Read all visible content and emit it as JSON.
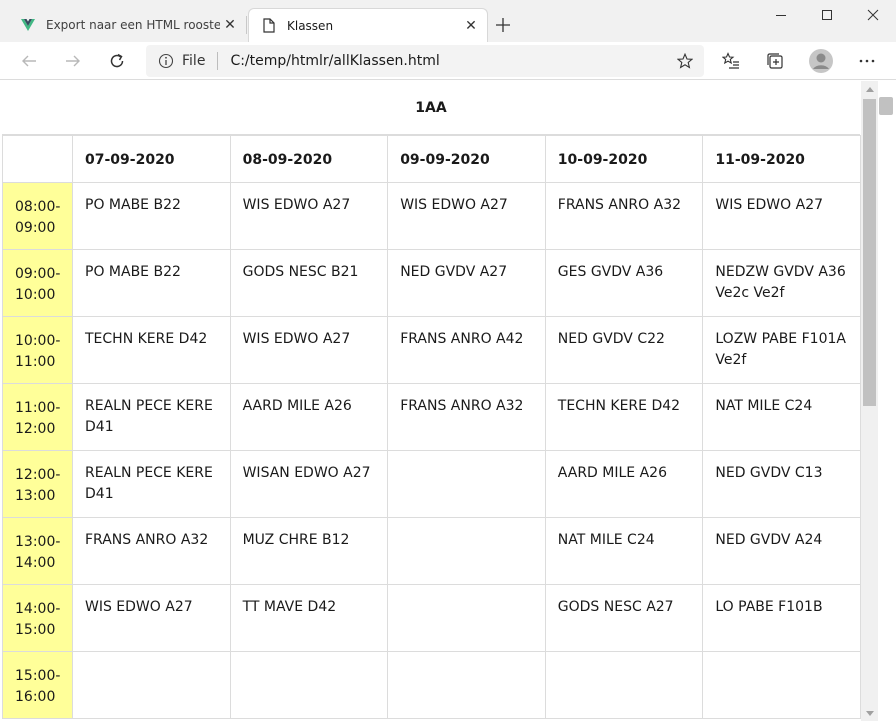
{
  "tabs": [
    {
      "title": "Export naar een HTML rooster –",
      "active": false
    },
    {
      "title": "Klassen",
      "active": true
    }
  ],
  "address": {
    "scheme": "File",
    "url": "C:/temp/htmlr/allKlassen.html"
  },
  "icons": {
    "tab1": "vue-logo-icon",
    "tab2": "page-icon",
    "back": "back-arrow-icon",
    "forward": "forward-arrow-icon",
    "reload": "reload-icon",
    "info": "info-icon",
    "favorite": "star-icon",
    "favorites": "favorites-icon",
    "collections": "collections-icon",
    "profile": "profile-icon",
    "menu": "more-icon"
  },
  "colors": {
    "time_cell": "#ffff99",
    "grid": "#dcdcdc"
  },
  "page": {
    "class_name": "1AA",
    "days": [
      "07-09-2020",
      "08-09-2020",
      "09-09-2020",
      "10-09-2020",
      "11-09-2020"
    ],
    "rows": [
      {
        "time": "08:00-09:00",
        "cells": [
          "PO MABE B22",
          "WIS EDWO A27",
          "WIS EDWO A27",
          "FRANS ANRO A32",
          "WIS EDWO A27"
        ]
      },
      {
        "time": "09:00-10:00",
        "cells": [
          "PO MABE B22",
          "GODS NESC B21",
          "NED GVDV A27",
          "GES GVDV A36",
          "NEDZW GVDV A36 Ve2c Ve2f"
        ]
      },
      {
        "time": "10:00-11:00",
        "cells": [
          "TECHN KERE D42",
          "WIS EDWO A27",
          "FRANS ANRO A42",
          "NED GVDV C22",
          "LOZW PABE F101A Ve2f"
        ]
      },
      {
        "time": "11:00-12:00",
        "cells": [
          "REALN PECE KERE D41",
          "AARD MILE A26",
          "FRANS ANRO A32",
          "TECHN KERE D42",
          "NAT MILE C24"
        ]
      },
      {
        "time": "12:00-13:00",
        "cells": [
          "REALN PECE KERE D41",
          "WISAN EDWO A27",
          "",
          "AARD MILE A26",
          "NED GVDV C13"
        ]
      },
      {
        "time": "13:00-14:00",
        "cells": [
          "FRANS ANRO A32",
          "MUZ CHRE B12",
          "",
          "NAT MILE C24",
          "NED GVDV A24"
        ]
      },
      {
        "time": "14:00-15:00",
        "cells": [
          "WIS EDWO A27",
          "TT MAVE D42",
          "",
          "GODS NESC A27",
          "LO PABE F101B"
        ]
      },
      {
        "time": "15:00-16:00",
        "cells": [
          "",
          "",
          "",
          "",
          ""
        ]
      }
    ]
  }
}
